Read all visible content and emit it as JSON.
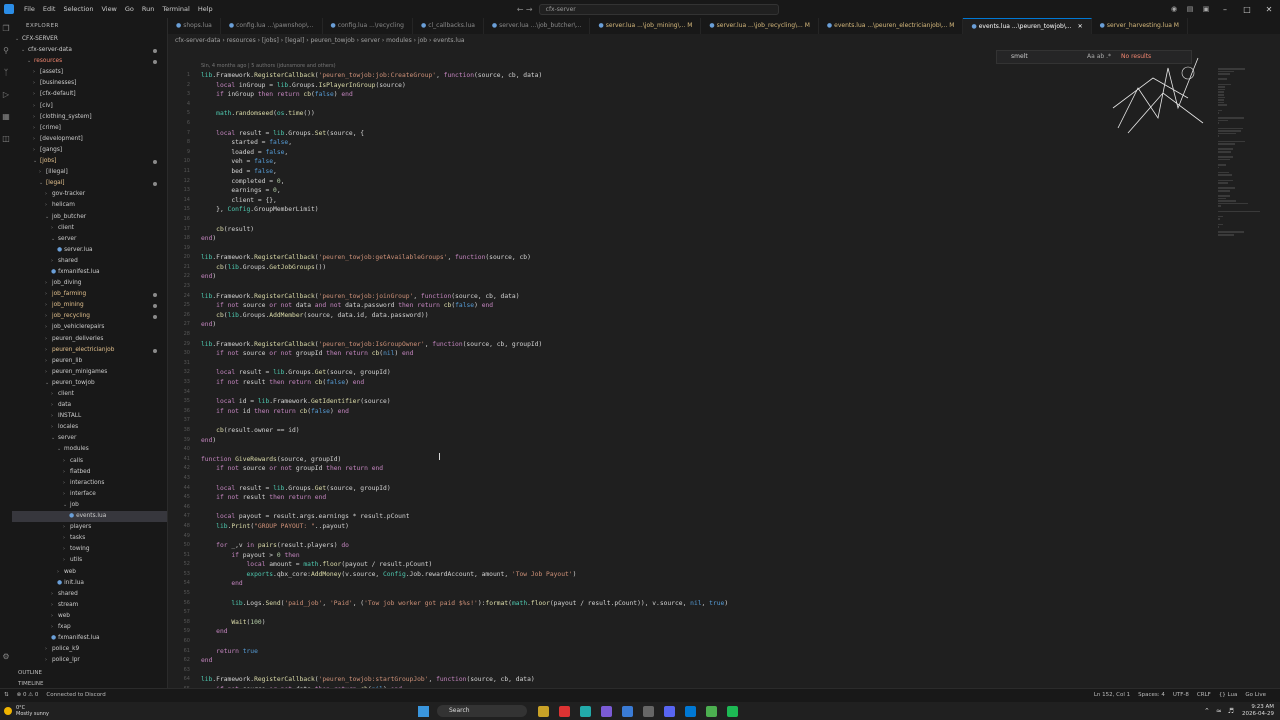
{
  "menu": [
    "File",
    "Edit",
    "Selection",
    "View",
    "Go",
    "Run",
    "Terminal",
    "Help"
  ],
  "title_search": "cfx-server",
  "explorer": {
    "title": "EXPLORER",
    "root": "CFX-SERVER",
    "items": [
      {
        "d": 1,
        "t": "cfx-server-data",
        "o": true,
        "c": "",
        "dot": true
      },
      {
        "d": 2,
        "t": "resources",
        "o": true,
        "c": "red",
        "dot": true
      },
      {
        "d": 3,
        "t": "[assets]",
        "o": false,
        "c": ""
      },
      {
        "d": 3,
        "t": "[businesses]",
        "o": false,
        "c": ""
      },
      {
        "d": 3,
        "t": "[cfx-default]",
        "o": false,
        "c": ""
      },
      {
        "d": 3,
        "t": "[civ]",
        "o": false,
        "c": ""
      },
      {
        "d": 3,
        "t": "[clothing_system]",
        "o": false,
        "c": ""
      },
      {
        "d": 3,
        "t": "[crime]",
        "o": false,
        "c": ""
      },
      {
        "d": 3,
        "t": "[development]",
        "o": false,
        "c": ""
      },
      {
        "d": 3,
        "t": "[gangs]",
        "o": false,
        "c": ""
      },
      {
        "d": 3,
        "t": "[jobs]",
        "o": true,
        "c": "mod",
        "dot": true
      },
      {
        "d": 4,
        "t": "[illegal]",
        "o": false,
        "c": ""
      },
      {
        "d": 4,
        "t": "[legal]",
        "o": true,
        "c": "mod",
        "dot": true
      },
      {
        "d": 5,
        "t": "gov-tracker",
        "o": false,
        "c": ""
      },
      {
        "d": 5,
        "t": "helicam",
        "o": false,
        "c": ""
      },
      {
        "d": 5,
        "t": "job_butcher",
        "o": true,
        "c": ""
      },
      {
        "d": 6,
        "t": "client",
        "o": false,
        "c": ""
      },
      {
        "d": 6,
        "t": "server",
        "o": true,
        "c": ""
      },
      {
        "d": 7,
        "t": "server.lua",
        "f": true,
        "c": ""
      },
      {
        "d": 6,
        "t": "shared",
        "o": false,
        "c": ""
      },
      {
        "d": 6,
        "t": "fxmanifest.lua",
        "f": true,
        "c": ""
      },
      {
        "d": 5,
        "t": "job_diving",
        "o": false,
        "c": ""
      },
      {
        "d": 5,
        "t": "job_farming",
        "o": false,
        "c": "mod",
        "dot": true
      },
      {
        "d": 5,
        "t": "job_mining",
        "o": false,
        "c": "mod",
        "dot": true
      },
      {
        "d": 5,
        "t": "job_recycling",
        "o": false,
        "c": "mod",
        "dot": true
      },
      {
        "d": 5,
        "t": "job_vehiclerepairs",
        "o": false,
        "c": ""
      },
      {
        "d": 5,
        "t": "peuren_deliveries",
        "o": false,
        "c": ""
      },
      {
        "d": 5,
        "t": "peuren_electricianjob",
        "o": false,
        "c": "mod",
        "dot": true
      },
      {
        "d": 5,
        "t": "peuren_lib",
        "o": false,
        "c": ""
      },
      {
        "d": 5,
        "t": "peuren_minigames",
        "o": false,
        "c": ""
      },
      {
        "d": 5,
        "t": "peuren_towjob",
        "o": true,
        "c": ""
      },
      {
        "d": 6,
        "t": "client",
        "o": false,
        "c": ""
      },
      {
        "d": 6,
        "t": "data",
        "o": false,
        "c": ""
      },
      {
        "d": 6,
        "t": "INSTALL",
        "o": false,
        "c": ""
      },
      {
        "d": 6,
        "t": "locales",
        "o": false,
        "c": ""
      },
      {
        "d": 6,
        "t": "server",
        "o": true,
        "c": ""
      },
      {
        "d": 7,
        "t": "modules",
        "o": true,
        "c": ""
      },
      {
        "d": 8,
        "t": "calls",
        "o": false,
        "c": ""
      },
      {
        "d": 8,
        "t": "flatbed",
        "o": false,
        "c": ""
      },
      {
        "d": 8,
        "t": "interactions",
        "o": false,
        "c": ""
      },
      {
        "d": 8,
        "t": "interface",
        "o": false,
        "c": ""
      },
      {
        "d": 8,
        "t": "job",
        "o": true,
        "c": ""
      },
      {
        "d": 9,
        "t": "events.lua",
        "f": true,
        "c": "",
        "active": true
      },
      {
        "d": 8,
        "t": "players",
        "o": false,
        "c": ""
      },
      {
        "d": 8,
        "t": "tasks",
        "o": false,
        "c": ""
      },
      {
        "d": 8,
        "t": "towing",
        "o": false,
        "c": ""
      },
      {
        "d": 8,
        "t": "utils",
        "o": false,
        "c": ""
      },
      {
        "d": 7,
        "t": "web",
        "o": false,
        "c": ""
      },
      {
        "d": 7,
        "t": "init.lua",
        "f": true,
        "c": ""
      },
      {
        "d": 6,
        "t": "shared",
        "o": false,
        "c": ""
      },
      {
        "d": 6,
        "t": "stream",
        "o": false,
        "c": ""
      },
      {
        "d": 6,
        "t": "web",
        "o": false,
        "c": ""
      },
      {
        "d": 6,
        "t": "fxap",
        "o": false,
        "c": ""
      },
      {
        "d": 6,
        "t": "fxmanifest.lua",
        "f": true,
        "c": ""
      },
      {
        "d": 5,
        "t": "police_k9",
        "o": false,
        "c": ""
      },
      {
        "d": 5,
        "t": "police_lpr",
        "o": false,
        "c": ""
      }
    ],
    "outline": "OUTLINE",
    "timeline": "TIMELINE"
  },
  "tabs": [
    {
      "label": "shops.lua",
      "state": ""
    },
    {
      "label": "config.lua ...\\pawnshop\\...",
      "state": ""
    },
    {
      "label": "config.lua ...\\recycling",
      "state": ""
    },
    {
      "label": "cl_callbacks.lua",
      "state": ""
    },
    {
      "label": "server.lua ...\\job_butcher\\...",
      "state": ""
    },
    {
      "label": "server.lua ...\\job_mining\\... M",
      "state": "mod"
    },
    {
      "label": "server.lua ...\\job_recycling\\... M",
      "state": "mod"
    },
    {
      "label": "events.lua ...\\peuren_electricianjob\\... M",
      "state": "mod"
    },
    {
      "label": "events.lua ...\\peuren_towjob\\...",
      "state": "active"
    },
    {
      "label": "server_harvesting.lua M",
      "state": "mod"
    }
  ],
  "breadcrumb": "cfx-server-data › resources › [jobs] › [legal] › peuren_towjob › server › modules › job › events.lua",
  "blame": "Sin, 4 months ago | 5 authors (jdunsmore and others)",
  "find": {
    "query": "smelt",
    "options": "Aa ab .*",
    "result": "No results"
  },
  "code_lines": [
    "lib.Framework.RegisterCallback('peuren_towjob:job:CreateGroup', function(source, cb, data)",
    "    local inGroup = lib.Groups.IsPlayerInGroup(source)",
    "    if inGroup then return cb(false) end",
    "",
    "    math.randomseed(os.time())",
    "",
    "    local result = lib.Groups.Set(source, {",
    "        started = false,",
    "        loaded = false,",
    "        veh = false,",
    "        bed = false,",
    "        completed = 0,",
    "        earnings = 0,",
    "        client = {},",
    "    }, Config.GroupMemberLimit)",
    "",
    "    cb(result)",
    "end)",
    "",
    "lib.Framework.RegisterCallback('peuren_towjob:getAvailableGroups', function(source, cb)",
    "    cb(lib.Groups.GetJobGroups())",
    "end)",
    "",
    "lib.Framework.RegisterCallback('peuren_towjob:joinGroup', function(source, cb, data)",
    "    if not source or not data and not data.password then return cb(false) end",
    "    cb(lib.Groups.AddMember(source, data.id, data.password))",
    "end)",
    "",
    "lib.Framework.RegisterCallback('peuren_towjob:IsGroupOwner', function(source, cb, groupId)",
    "    if not source or not groupId then return cb(nil) end",
    "",
    "    local result = lib.Groups.Get(source, groupId)",
    "    if not result then return cb(false) end",
    "",
    "    local id = lib.Framework.GetIdentifier(source)",
    "    if not id then return cb(false) end",
    "",
    "    cb(result.owner == id)",
    "end)",
    "",
    "function GiveRewards(source, groupId)",
    "    if not source or not groupId then return end",
    "",
    "    local result = lib.Groups.Get(source, groupId)",
    "    if not result then return end",
    "",
    "    local payout = result.args.earnings * result.pCount",
    "    lib.Print(\"GROUP PAYOUT: \"..payout)",
    "",
    "    for _,v in pairs(result.players) do",
    "        if payout > 0 then",
    "            local amount = math.floor(payout / result.pCount)",
    "            exports.qbx_core:AddMoney(v.source, Config.Job.rewardAccount, amount, 'Tow Job Payout')",
    "        end",
    "",
    "        lib.Logs.Send('paid_job', 'Paid', ('Tow job worker got paid $%s!'):format(math.floor(payout / result.pCount)), v.source, nil, true)",
    "",
    "        Wait(100)",
    "    end",
    "",
    "    return true",
    "end",
    "",
    "lib.Framework.RegisterCallback('peuren_towjob:startGroupJob', function(source, cb, data)",
    "    if not source or not data then return cb(nil) end"
  ],
  "status": {
    "left": [
      "Connected to Discord"
    ],
    "problems": "⊗ 0 ⚠ 0",
    "right": [
      "Ln 152, Col 1",
      "Spaces: 4",
      "UTF-8",
      "CRLF",
      "{} Lua",
      "Go Live"
    ]
  },
  "taskbar": {
    "weather_temp": "0°C",
    "weather_desc": "Mostly sunny",
    "search": "Search",
    "time": "9:23 AM",
    "date": "2026-04-29"
  }
}
